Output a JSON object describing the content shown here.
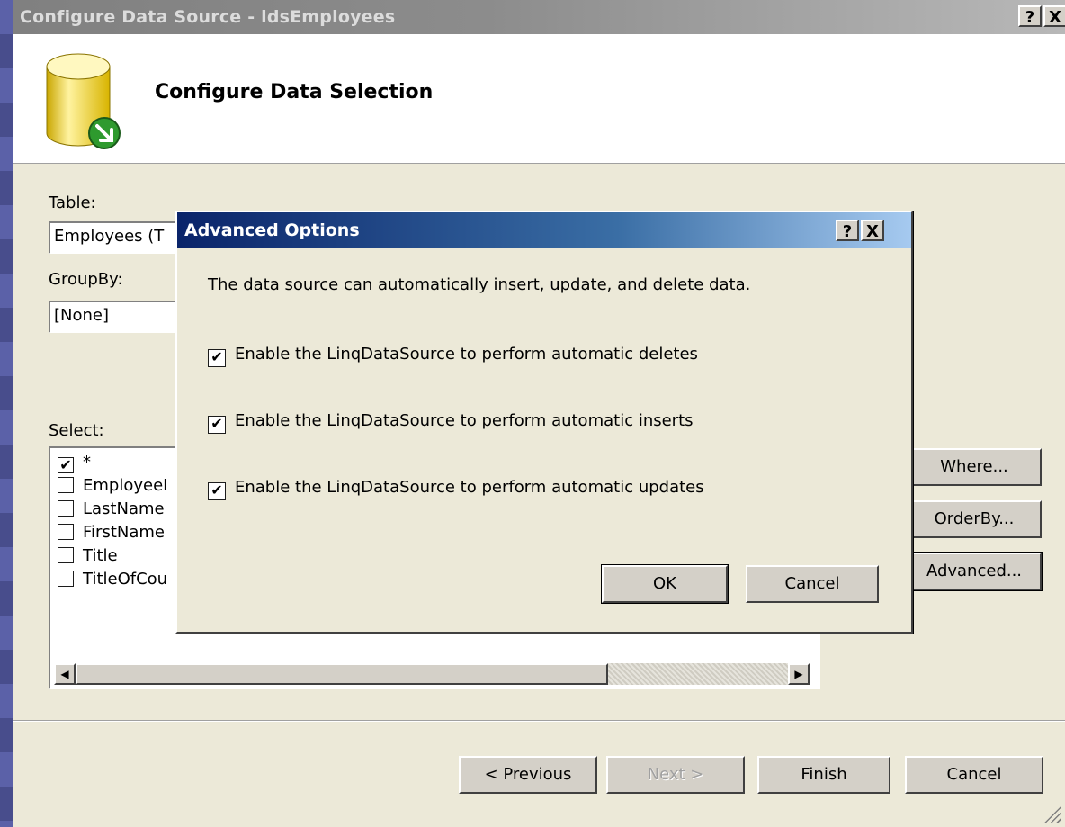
{
  "window": {
    "title": "Configure Data Source - ldsEmployees",
    "help_btn": "?",
    "close_btn": "X"
  },
  "header": {
    "title": "Configure Data Selection"
  },
  "form": {
    "table_label": "Table:",
    "table_value": "Employees (T",
    "groupby_label": "GroupBy:",
    "groupby_value": "[None]",
    "select_label": "Select:"
  },
  "select_list": [
    {
      "label": "*",
      "checked": true
    },
    {
      "label": "EmployeeI",
      "checked": false
    },
    {
      "label": "LastName",
      "checked": false
    },
    {
      "label": "FirstName",
      "checked": false
    },
    {
      "label": "Title",
      "checked": false
    },
    {
      "label": "TitleOfCou",
      "checked": false
    }
  ],
  "side_buttons": {
    "where": "Where...",
    "orderby": "OrderBy...",
    "advanced": "Advanced..."
  },
  "footer_buttons": {
    "previous": "< Previous",
    "next": "Next >",
    "finish": "Finish",
    "cancel": "Cancel"
  },
  "scrollbar": {
    "left": "◀",
    "right": "▶"
  },
  "modal": {
    "title": "Advanced Options",
    "help_btn": "?",
    "close_btn": "X",
    "description": "The data source can automatically insert, update, and delete data.",
    "options": [
      {
        "label": "Enable the LinqDataSource to perform automatic deletes",
        "checked": true
      },
      {
        "label": "Enable the LinqDataSource to perform automatic inserts",
        "checked": true
      },
      {
        "label": "Enable the LinqDataSource to perform automatic updates",
        "checked": true
      }
    ],
    "ok": "OK",
    "cancel": "Cancel"
  },
  "colors": {
    "desktop": "#4a4f8c",
    "dialog_face": "#ece9d8",
    "active_title_start": "#0a246a",
    "active_title_end": "#a6caf0",
    "check_mark": "✔"
  }
}
